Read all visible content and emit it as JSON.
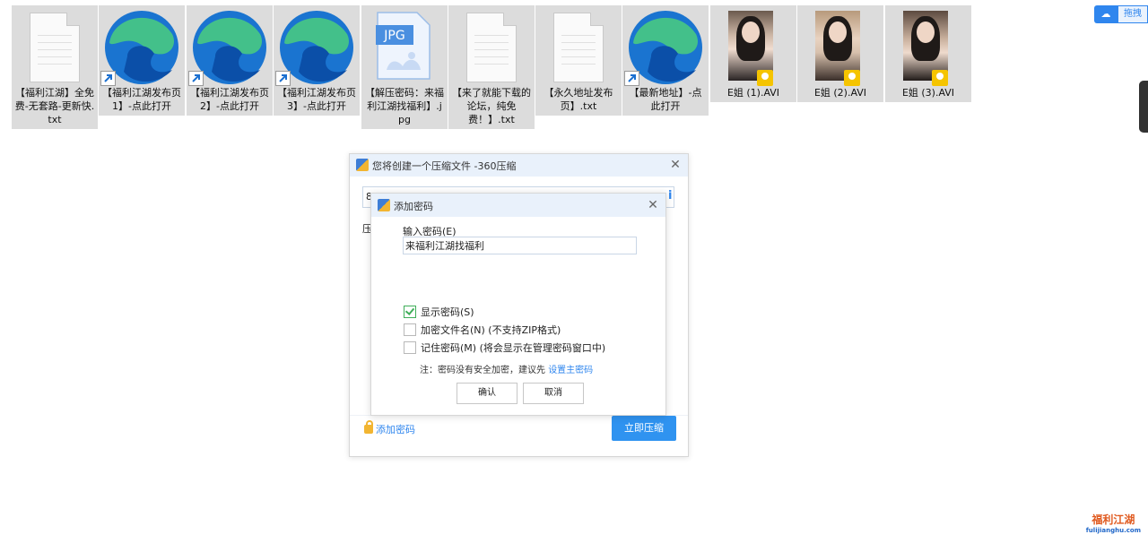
{
  "desktop": {
    "files": [
      {
        "type": "txt",
        "label": "【福利江湖】全免费-无套路-更新快.txt"
      },
      {
        "type": "edge-shortcut",
        "label": "【福利江湖发布页1】-点此打开"
      },
      {
        "type": "edge-shortcut",
        "label": "【福利江湖发布页2】-点此打开"
      },
      {
        "type": "edge-shortcut",
        "label": "【福利江湖发布页3】-点此打开"
      },
      {
        "type": "jpg",
        "label": "【解压密码：来福利江湖找福利】.jpg",
        "badge": "JPG"
      },
      {
        "type": "txt",
        "label": "【来了就能下载的论坛，纯免费！】.txt"
      },
      {
        "type": "txt",
        "label": "【永久地址发布页】.txt"
      },
      {
        "type": "edge-shortcut",
        "label": "【最新地址】-点此打开"
      },
      {
        "type": "video",
        "label": "E姐 (1).AVI",
        "badge": "Player"
      },
      {
        "type": "video",
        "label": "E姐 (2).AVI",
        "badge": "Player"
      },
      {
        "type": "video",
        "label": "E姐 (3).AVI",
        "badge": "Player"
      }
    ]
  },
  "top_right": {
    "caption": "拖拽"
  },
  "compress_dialog": {
    "title": "您将创建一个压缩文件 -360压缩",
    "path_value": "8",
    "left_label": "压",
    "add_password_link": "添加密码",
    "compress_button": "立即压缩"
  },
  "password_dialog": {
    "title": "添加密码",
    "input_label": "输入密码(E)",
    "input_value": "来福利江湖找福利",
    "options": [
      {
        "label": "显示密码(S)",
        "checked": true
      },
      {
        "label": "加密文件名(N) (不支持ZIP格式)",
        "checked": false
      },
      {
        "label": "记住密码(M) (将会显示在管理密码窗口中)",
        "checked": false
      }
    ],
    "note_text": "注：密码没有安全加密，建议先 ",
    "note_link": "设置主密码",
    "confirm_button": "确认",
    "cancel_button": "取消"
  },
  "watermark": {
    "brand": "福利江湖",
    "domain": "fulijianghu.com"
  },
  "colors": {
    "accent": "#2f93f0",
    "link": "#2f86ee",
    "check": "#3fae59",
    "file_bg": "#dcdcdc"
  }
}
